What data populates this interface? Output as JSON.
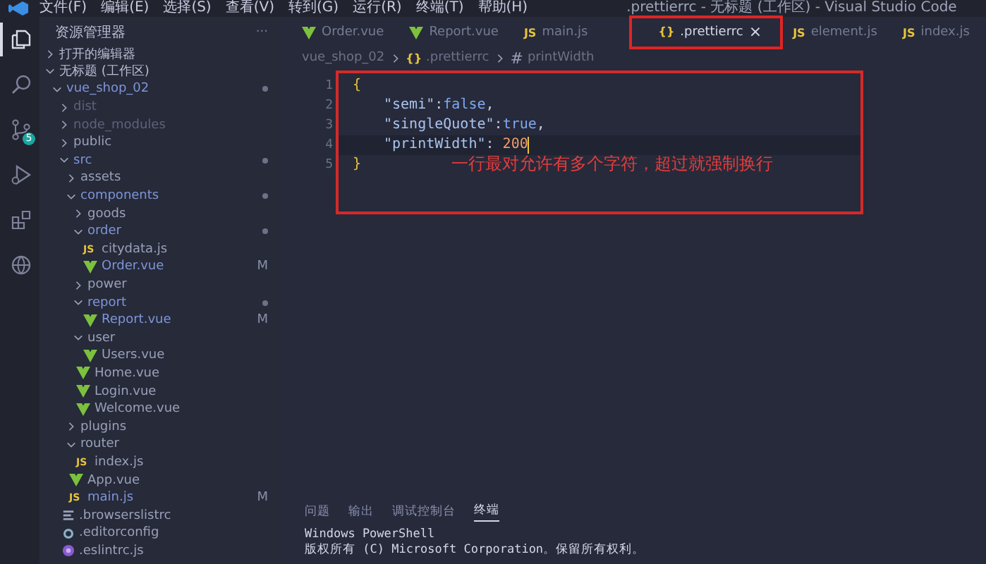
{
  "title_bar": {
    "menus": [
      "文件(F)",
      "编辑(E)",
      "选择(S)",
      "查看(V)",
      "转到(G)",
      "运行(R)",
      "终端(T)",
      "帮助(H)"
    ],
    "title": ".prettierrc - 无标题 (工作区) - Visual Studio Code"
  },
  "activity_bar": [
    {
      "kind": "explorer",
      "selected": true
    },
    {
      "kind": "search",
      "selected": false
    },
    {
      "kind": "source-control",
      "selected": false,
      "badge": "5"
    },
    {
      "kind": "run",
      "selected": false
    },
    {
      "kind": "extensions",
      "selected": false
    },
    {
      "kind": "remote",
      "selected": false
    }
  ],
  "sidebar": {
    "title": "资源管理器",
    "more": "···",
    "tree": [
      {
        "kind": "section",
        "label": "打开的编辑器",
        "expanded": false
      },
      {
        "kind": "section",
        "label": "无标题 (工作区)",
        "expanded": true,
        "children": [
          {
            "kind": "folder",
            "label": "vue_shop_02",
            "expanded": true,
            "changed": true,
            "ignored": false,
            "children": [
              {
                "kind": "folder",
                "label": "dist",
                "expanded": false,
                "changed": false,
                "ignored": true
              },
              {
                "kind": "folder",
                "label": "node_modules",
                "expanded": false,
                "changed": false,
                "ignored": true
              },
              {
                "kind": "folder",
                "label": "public",
                "expanded": false,
                "changed": false,
                "ignored": false
              },
              {
                "kind": "folder",
                "label": "src",
                "expanded": true,
                "changed": true,
                "ignored": false,
                "children": [
                  {
                    "kind": "folder",
                    "label": "assets",
                    "expanded": false,
                    "changed": false,
                    "ignored": false
                  },
                  {
                    "kind": "folder",
                    "label": "components",
                    "expanded": true,
                    "changed": true,
                    "ignored": false,
                    "children": [
                      {
                        "kind": "folder",
                        "label": "goods",
                        "expanded": false,
                        "changed": false,
                        "ignored": false
                      },
                      {
                        "kind": "folder",
                        "label": "order",
                        "expanded": true,
                        "changed": true,
                        "ignored": false,
                        "children": [
                          {
                            "kind": "js",
                            "label": "citydata.js",
                            "icon_text": "JS"
                          },
                          {
                            "kind": "vue",
                            "label": "Order.vue",
                            "status": "M"
                          }
                        ]
                      },
                      {
                        "kind": "folder",
                        "label": "power",
                        "expanded": false,
                        "changed": false,
                        "ignored": false
                      },
                      {
                        "kind": "folder",
                        "label": "report",
                        "expanded": true,
                        "changed": true,
                        "ignored": false,
                        "children": [
                          {
                            "kind": "vue",
                            "label": "Report.vue",
                            "status": "M"
                          }
                        ]
                      },
                      {
                        "kind": "folder",
                        "label": "user",
                        "expanded": true,
                        "changed": false,
                        "ignored": false,
                        "children": [
                          {
                            "kind": "vue",
                            "label": "Users.vue"
                          }
                        ]
                      },
                      {
                        "kind": "vue",
                        "label": "Home.vue"
                      },
                      {
                        "kind": "vue",
                        "label": "Login.vue"
                      },
                      {
                        "kind": "vue",
                        "label": "Welcome.vue"
                      }
                    ]
                  },
                  {
                    "kind": "folder",
                    "label": "plugins",
                    "expanded": false,
                    "changed": false,
                    "ignored": false
                  },
                  {
                    "kind": "folder",
                    "label": "router",
                    "expanded": true,
                    "changed": false,
                    "ignored": false,
                    "children": [
                      {
                        "kind": "js",
                        "label": "index.js",
                        "icon_text": "JS"
                      }
                    ]
                  },
                  {
                    "kind": "vue",
                    "label": "App.vue"
                  },
                  {
                    "kind": "js",
                    "label": "main.js",
                    "icon_text": "JS",
                    "status": "M"
                  }
                ]
              },
              {
                "kind": "list",
                "label": ".browserslistrc"
              },
              {
                "kind": "config",
                "label": ".editorconfig"
              },
              {
                "kind": "eslint",
                "label": ".eslintrc.js"
              }
            ]
          }
        ]
      }
    ]
  },
  "tabs": [
    {
      "kind": "vue",
      "label": "Order.vue",
      "selected": false,
      "highlighted": false
    },
    {
      "kind": "vue",
      "label": "Report.vue",
      "selected": false,
      "highlighted": false
    },
    {
      "kind": "js",
      "label": "main.js",
      "icon_text": "JS",
      "selected": false,
      "highlighted": false
    },
    {
      "kind": "json",
      "label": ".prettierrc",
      "icon_text": "{}",
      "close": "×",
      "selected": true,
      "highlighted": true
    },
    {
      "kind": "js",
      "label": "element.js",
      "icon_text": "JS",
      "selected": false,
      "highlighted": false
    },
    {
      "kind": "js",
      "label": "index.js",
      "icon_text": "JS",
      "selected": false,
      "highlighted": false
    }
  ],
  "breadcrumb": [
    {
      "label": "vue_shop_02"
    },
    {
      "kind": "json",
      "label": ".prettierrc",
      "icon_text": "{}"
    },
    {
      "kind": "property",
      "label": "printWidth",
      "icon_text": "#"
    }
  ],
  "editor": {
    "highlighted": true,
    "lines": [
      {
        "number": "1",
        "active": false,
        "indented": false,
        "tokens": [
          {
            "kind": "brace",
            "text": "{"
          }
        ]
      },
      {
        "number": "2",
        "active": false,
        "indented": true,
        "tokens": [
          {
            "kind": "key",
            "text": "\"semi\""
          },
          {
            "kind": "punct",
            "text": ":"
          },
          {
            "kind": "keyword",
            "text": "false"
          },
          {
            "kind": "punct",
            "text": ","
          }
        ]
      },
      {
        "number": "3",
        "active": false,
        "indented": true,
        "tokens": [
          {
            "kind": "key",
            "text": "\"singleQuote\""
          },
          {
            "kind": "punct",
            "text": ":"
          },
          {
            "kind": "keyword",
            "text": "true"
          },
          {
            "kind": "punct",
            "text": ","
          }
        ]
      },
      {
        "number": "4",
        "active": true,
        "indented": true,
        "tokens": [
          {
            "kind": "key",
            "text": "\"printWidth\""
          },
          {
            "kind": "punct",
            "text": ": "
          },
          {
            "kind": "number",
            "text": "200"
          }
        ]
      },
      {
        "number": "5",
        "active": false,
        "indented": false,
        "tokens": [
          {
            "kind": "brace",
            "text": "}"
          }
        ]
      }
    ],
    "annotation": "一行最对允许有多个字符，超过就强制换行"
  },
  "panel": {
    "tabs": [
      {
        "label": "问题",
        "selected": false
      },
      {
        "label": "输出",
        "selected": false
      },
      {
        "label": "调试控制台",
        "selected": false
      },
      {
        "label": "终端",
        "selected": true
      }
    ],
    "terminal_lines": [
      "Windows PowerShell",
      "版权所有 (C) Microsoft Corporation。保留所有权利。"
    ]
  }
}
